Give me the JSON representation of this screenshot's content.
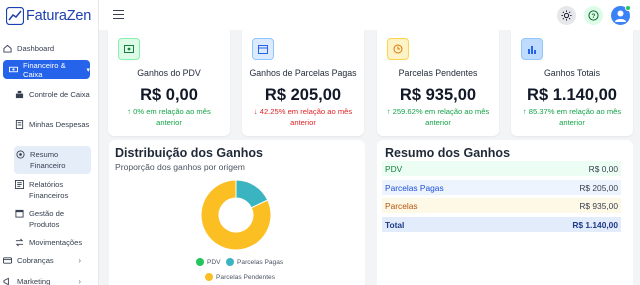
{
  "app": {
    "name": "FaturaZen"
  },
  "sidebar": {
    "dashboard": "Dashboard",
    "active_group": "Financeiro & Caixa",
    "subitems": [
      {
        "label": "Controle de Caixa"
      },
      {
        "label": "Minhas Despesas"
      },
      {
        "label": "Resumo Financeiro"
      },
      {
        "label": "Relatórios Financeiros"
      },
      {
        "label": "Gestão de Produtos"
      },
      {
        "label": "Movimentações"
      }
    ],
    "cobrancas": "Cobranças",
    "marketing": "Marketing"
  },
  "cards": [
    {
      "title": "Ganhos do PDV",
      "value": "R$ 0,00",
      "delta": "↑ 0% em relação ao mês anterior",
      "trend": "up",
      "icon": "money-icon",
      "color": "#16a34a",
      "bg": "#dcfce7"
    },
    {
      "title": "Ganhos de Parcelas Pagas",
      "value": "R$ 205,00",
      "delta": "↓ 42.25% em relação ao mês anterior",
      "trend": "down",
      "icon": "wallet-icon",
      "color": "#2563eb",
      "bg": "#dbeafe"
    },
    {
      "title": "Parcelas Pendentes",
      "value": "R$ 935,00",
      "delta": "↑ 259.62% em relação ao mês anterior",
      "trend": "up",
      "icon": "clock-icon",
      "color": "#d97706",
      "bg": "#fef3c7"
    },
    {
      "title": "Ganhos Totais",
      "value": "R$ 1.140,00",
      "delta": "↑ 85.37% em relação ao mês anterior",
      "trend": "up",
      "icon": "chart-icon",
      "color": "#2563eb",
      "bg": "#bfdbfe"
    }
  ],
  "distribution": {
    "title": "Distribuição dos Ganhos",
    "subtitle": "Proporção dos ganhos por origem",
    "legend": [
      "PDV",
      "Parcelas Pagas",
      "Parcelas Pendentes"
    ],
    "slices": [
      {
        "label": "PDV",
        "value": 0,
        "color": "#22c55e"
      },
      {
        "label": "Parcelas Pagas",
        "value": 205,
        "color": "#3bb4c1"
      },
      {
        "label": "Parcelas Pendentes",
        "value": 935,
        "color": "#fbbf24"
      }
    ]
  },
  "summary": {
    "title": "Resumo dos Ganhos",
    "rows": [
      {
        "label": "PDV",
        "value": "R$ 0,00",
        "bg": "#ecfdf3",
        "color": "#15803d"
      },
      {
        "label": "Parcelas Pagas",
        "value": "R$ 205,00",
        "bg": "#eef4fe",
        "color": "#1d4ed8"
      },
      {
        "label": "Parcelas",
        "value": "R$ 935,00",
        "bg": "#fef9e7",
        "color": "#b45309"
      },
      {
        "label": "Total",
        "value": "R$ 1.140,00",
        "bg": "#e3ecfb",
        "color": "#1e3a8a"
      }
    ]
  }
}
